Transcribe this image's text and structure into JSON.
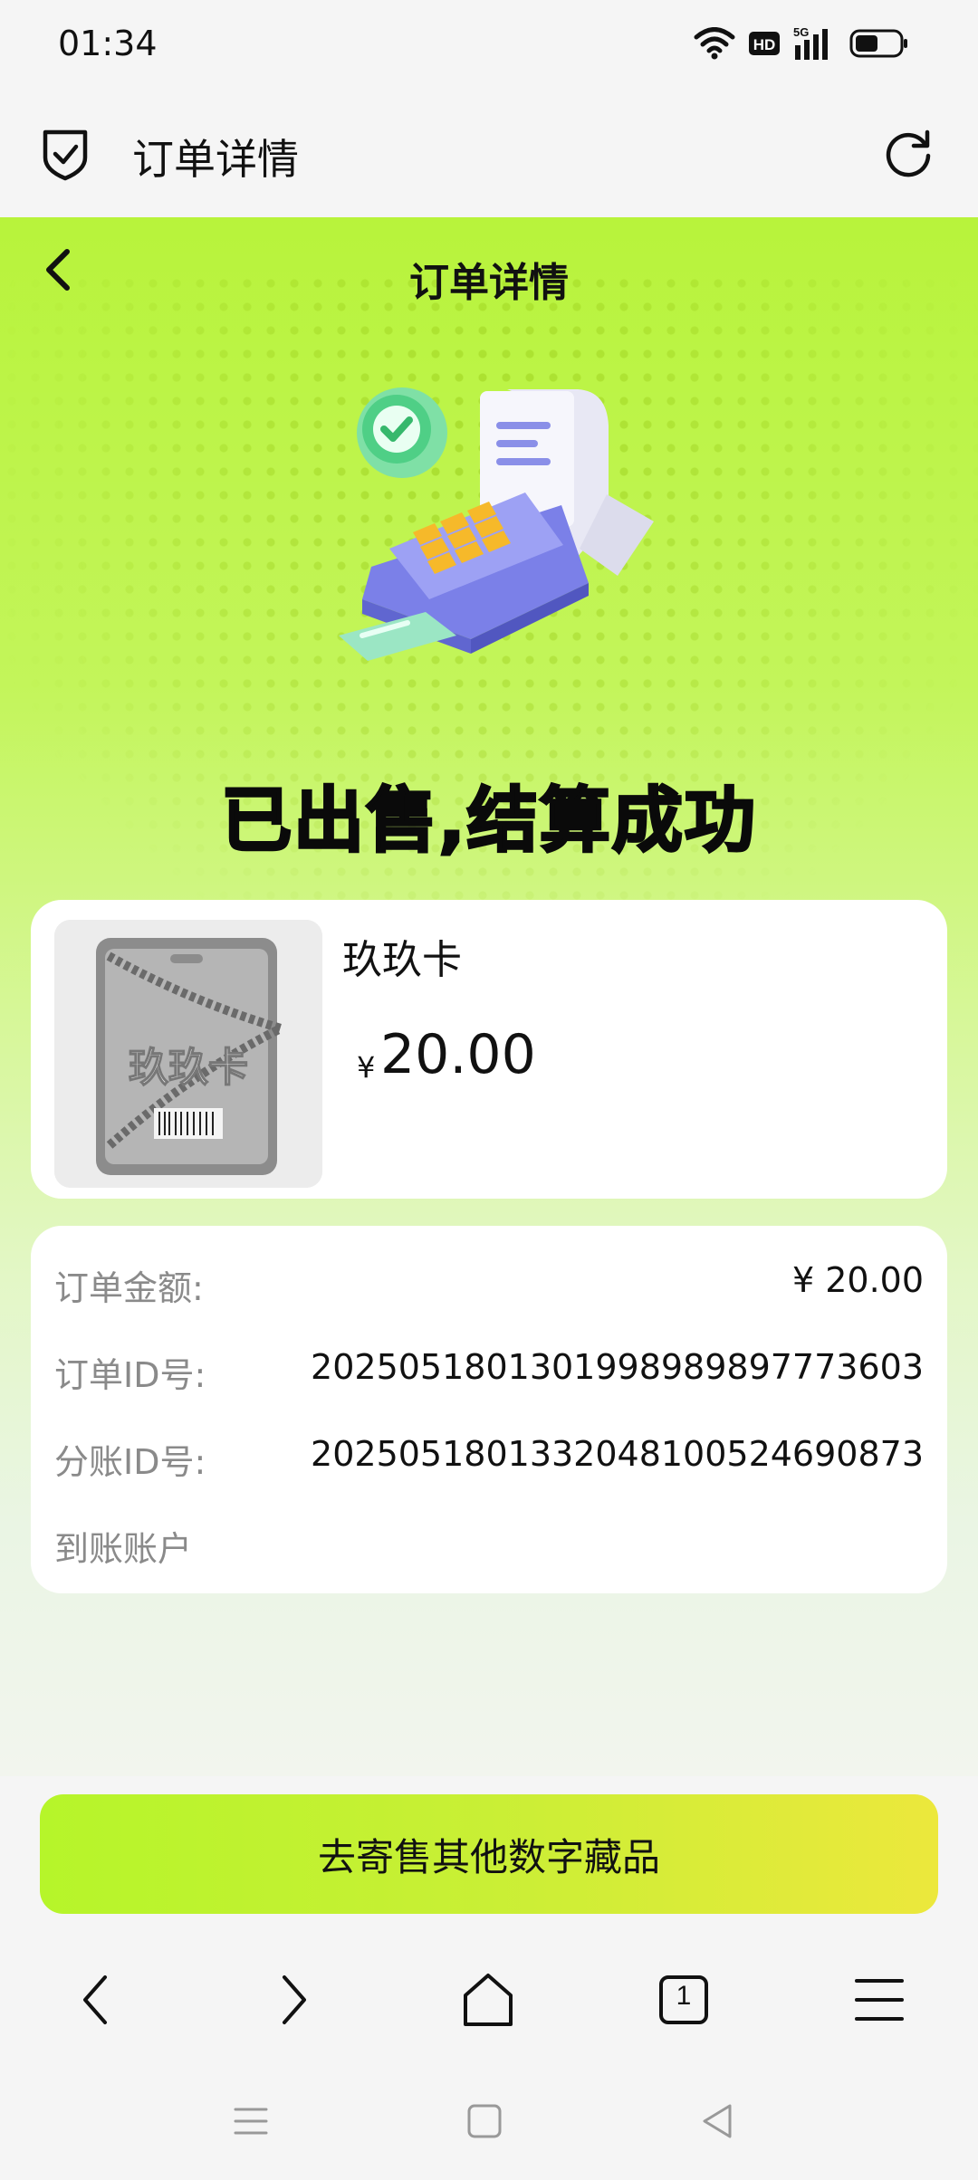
{
  "status_bar": {
    "time": "01:34",
    "icons": [
      "wifi-icon",
      "hd-icon",
      "5g-signal-icon",
      "battery-icon"
    ]
  },
  "browser_header": {
    "title": "订单详情",
    "left_icon": "shield-check-icon",
    "right_icon": "refresh-icon"
  },
  "page": {
    "title": "订单详情",
    "success_message": "已出售,结算成功"
  },
  "product": {
    "name": "玖玖卡",
    "currency": "¥",
    "price": "20.00"
  },
  "order_info": {
    "rows": [
      {
        "label": "订单金额:",
        "value": "¥ 20.00"
      },
      {
        "label": "订单ID号:",
        "value": "2025051801301998989897773603"
      },
      {
        "label": "分账ID号:",
        "value": "2025051801332048100524690873"
      },
      {
        "label": "到账账户",
        "value": ""
      }
    ]
  },
  "cta": {
    "label": "去寄售其他数字藏品"
  },
  "browser_nav": {
    "tab_count": "1",
    "icons": [
      "back-arrow-icon",
      "forward-arrow-icon",
      "home-icon",
      "tabs-icon",
      "menu-icon"
    ]
  },
  "system_nav": {
    "icons": [
      "recents-icon",
      "home-square-icon",
      "back-triangle-icon"
    ]
  },
  "colors": {
    "accent_green": "#b8f33b",
    "cta_start": "#b6f52a",
    "cta_end": "#ece83c",
    "label_gray": "#8a8a8a"
  }
}
